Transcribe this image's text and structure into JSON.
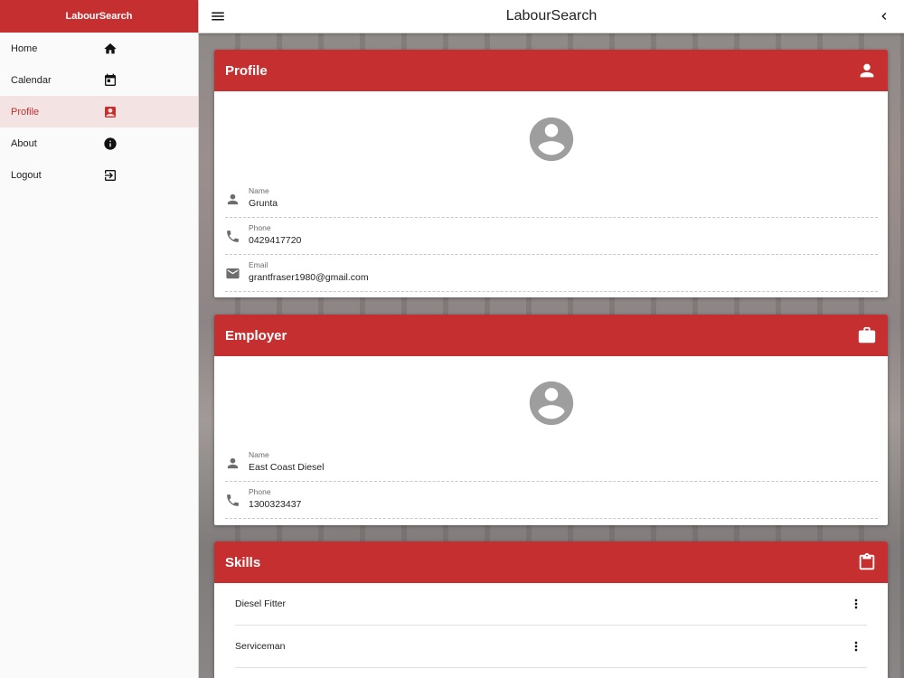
{
  "app": {
    "title": "LabourSearch",
    "sidebar_title": "LabourSearch"
  },
  "sidebar": {
    "items": [
      {
        "label": "Home",
        "icon": "home-icon"
      },
      {
        "label": "Calendar",
        "icon": "calendar-icon"
      },
      {
        "label": "Profile",
        "icon": "contact-icon",
        "active": true
      },
      {
        "label": "About",
        "icon": "info-icon"
      },
      {
        "label": "Logout",
        "icon": "exit-icon"
      }
    ]
  },
  "profile": {
    "title": "Profile",
    "name_label": "Name",
    "name": "Grunta",
    "phone_label": "Phone",
    "phone": "0429417720",
    "email_label": "Email",
    "email": "grantfraser1980@gmail.com"
  },
  "employer": {
    "title": "Employer",
    "name_label": "Name",
    "name": "East Coast Diesel",
    "phone_label": "Phone",
    "phone": "1300323437"
  },
  "skills": {
    "title": "Skills",
    "items": [
      "Diesel Fitter",
      "Serviceman"
    ]
  },
  "colors": {
    "accent": "#c62f2f",
    "active_bg": "#f3e3e3"
  }
}
